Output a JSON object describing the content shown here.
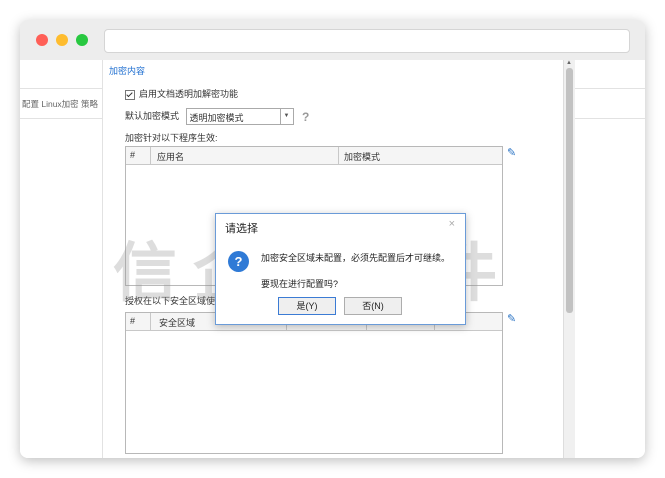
{
  "left_panel": {
    "label": "配置 Linux加密 策略"
  },
  "section": {
    "title": "加密内容"
  },
  "settings": {
    "enable_checkbox_label": "启用文档透明加解密功能",
    "default_mode_label": "默认加密模式",
    "default_mode_value": "透明加密模式",
    "help_icon_text": "?",
    "apply_label": "加密针对以下程序生效:"
  },
  "apps_table": {
    "columns": [
      "#",
      "应用名",
      "加密模式"
    ],
    "rows": []
  },
  "auth_label": "授权在以下安全区域使",
  "zones_table": {
    "columns": [
      "#",
      "安全区域",
      "",
      "",
      ""
    ],
    "rows": []
  },
  "watermark": "信企卫软件",
  "dialog": {
    "title": "请选择",
    "close_label": "×",
    "icon_text": "?",
    "message": "加密安全区域未配置，必须先配置后才可继续。",
    "question": "要现在进行配置吗?",
    "yes_label": "是(Y)",
    "no_label": "否(N)"
  },
  "colors": {
    "accent": "#1f6fd0",
    "dialog_border": "#6a9bd8",
    "close_red": "#ff5f57",
    "min_yellow": "#febc2e",
    "max_green": "#28c840"
  }
}
